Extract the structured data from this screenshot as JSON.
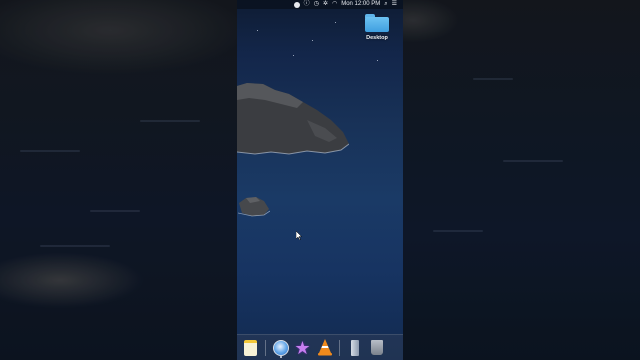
{
  "menubar": {
    "time": "Mon 12:00 PM",
    "icons": [
      "record-icon",
      "info-icon",
      "clock-icon",
      "accessibility-icon",
      "wifi-icon",
      "search-icon",
      "control-center-icon"
    ]
  },
  "desktop": {
    "folder_label": "Desktop"
  },
  "dock": {
    "items": [
      "notes-icon",
      "safari-icon",
      "imovie-star-icon",
      "vlc-icon",
      "preview-icon",
      "trash-icon"
    ]
  },
  "colors": {
    "folder": "#5fb4ea",
    "vlc_orange": "#f08a1c",
    "sky": "#13264a",
    "sea": "#1a3a66"
  }
}
